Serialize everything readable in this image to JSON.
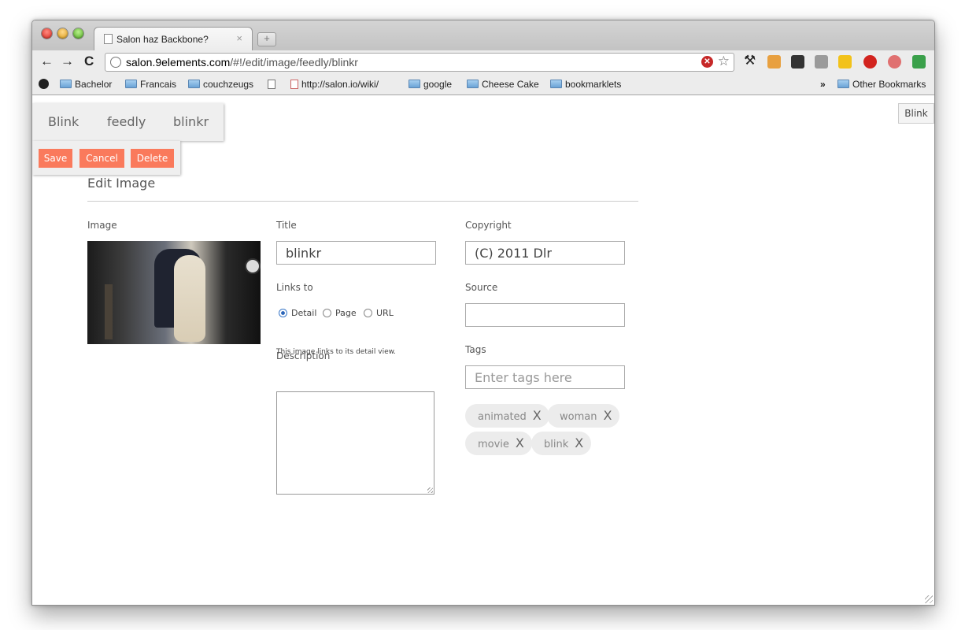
{
  "browser": {
    "tab_title": "Salon haz Backbone?",
    "tab_close": "×",
    "new_tab": "+",
    "back": "←",
    "forward": "→",
    "reload": "C",
    "url_host": "salon.9elements.com",
    "url_path": "/#!/edit/image/feedly/blinkr",
    "bookmarks": [
      "Bachelor",
      "Francais",
      "couchzeugs",
      "http://salon.io/wiki/",
      "google",
      "Cheese Cake",
      "bookmarklets"
    ],
    "bookmarks_overflow": "»",
    "other_bookmarks": "Other Bookmarks"
  },
  "breadcrumb": [
    "Blink",
    "feedly",
    "blinkr"
  ],
  "actions": {
    "save": "Save",
    "cancel": "Cancel",
    "delete": "Delete"
  },
  "corner_button": "Blink",
  "form": {
    "heading": "Edit Image",
    "image_label": "Image",
    "title_label": "Title",
    "title_value": "blinkr",
    "links_to_label": "Links to",
    "link_options": [
      "Detail",
      "Page",
      "URL"
    ],
    "link_selected": "Detail",
    "link_hint": "This image links to its detail view.",
    "description_label": "Description",
    "description_value": "",
    "copyright_label": "Copyright",
    "copyright_value": "(C) 2011 Dlr",
    "source_label": "Source",
    "source_value": "",
    "tags_label": "Tags",
    "tags_placeholder": "Enter tags here",
    "tags": [
      "animated",
      "woman",
      "movie",
      "blink"
    ],
    "tag_remove": "X"
  },
  "colors": {
    "action_button": "#fa7a5c",
    "panel": "#efefef"
  }
}
